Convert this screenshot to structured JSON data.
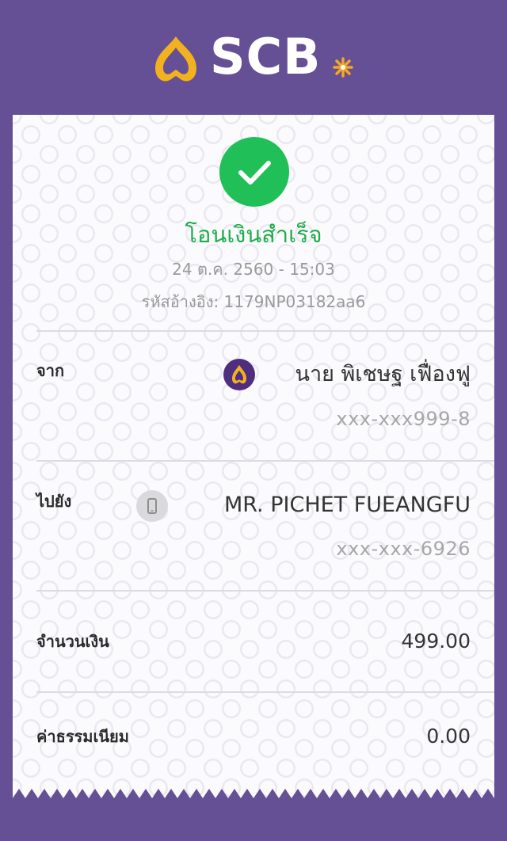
{
  "header": {
    "logo_text": "SCB",
    "colors": {
      "background": "#654f95",
      "logo_gold": "#f2b21f",
      "logo_star": "#f5a623"
    }
  },
  "receipt": {
    "status": {
      "icon": "check-icon",
      "title": "โอนเงินสำเร็จ",
      "color": "#21bf57"
    },
    "datetime": "24 ต.ค. 2560 - 15:03",
    "reference": "รหัสอ้างอิง: 1179NP03182aa6",
    "from": {
      "label": "จาก",
      "icon": "scb-bank-icon",
      "name": "นาย พิเชษฐ เฟื่องฟู",
      "account": "xxx-xxx999-8"
    },
    "to": {
      "label": "ไปยัง",
      "icon": "mobile-phone-icon",
      "name": "MR. PICHET FUEANGFU",
      "account": "xxx-xxx-6926"
    },
    "amount": {
      "label": "จำนวนเงิน",
      "value": "499.00"
    },
    "fee": {
      "label": "ค่าธรรมเนียม",
      "value": "0.00"
    }
  }
}
